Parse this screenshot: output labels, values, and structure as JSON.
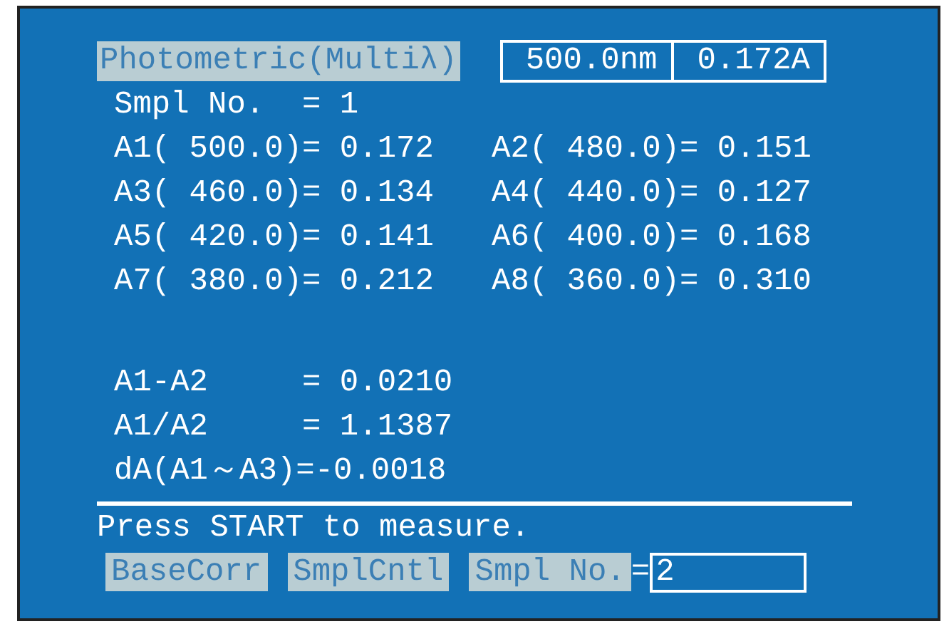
{
  "header": {
    "title": "Photometric(Multiλ)",
    "wavelength": "500.0nm",
    "absorbance": "0.172A"
  },
  "sample_line": "Smpl No.  = 1",
  "readings": [
    [
      "A1( 500.0)= 0.172",
      "A2( 480.0)= 0.151"
    ],
    [
      "A3( 460.0)= 0.134",
      "A4( 440.0)= 0.127"
    ],
    [
      "A5( 420.0)= 0.141",
      "A6( 400.0)= 0.168"
    ],
    [
      "A7( 380.0)= 0.212",
      "A8( 360.0)= 0.310"
    ]
  ],
  "calculations": [
    "A1-A2     = 0.0210",
    "A1/A2     = 1.1387",
    "dA(A1～A3)=-0.0018"
  ],
  "message": "Press START to measure.",
  "softkeys": [
    {
      "label": "BaseCorr"
    },
    {
      "label": "SmplCntl"
    },
    {
      "label": "Smpl No."
    }
  ],
  "input": {
    "label": "=",
    "value": "2"
  }
}
